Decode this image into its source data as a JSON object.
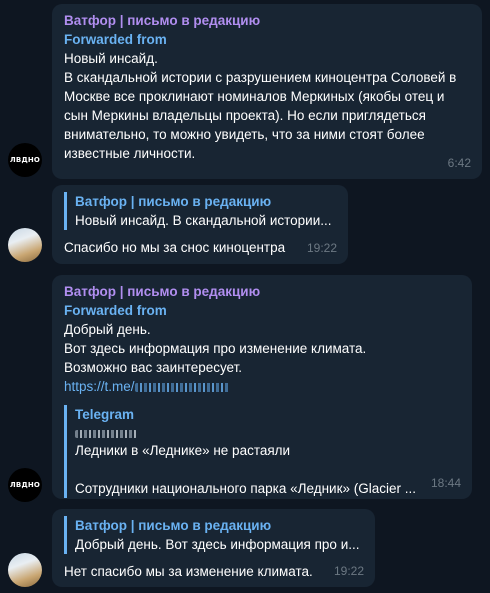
{
  "messages": [
    {
      "sender": "Ватфор | письмо в редакцию",
      "forwarded_label": "Forwarded from",
      "lines": [
        "Новый инсайд.",
        "В скандальной истории с разрушением киноцентра Соловей в",
        "Москве все проклинают номиналов Меркиных (якобы отец и",
        "сын Меркины владельцы проекта). Но если приглядеться",
        "внимательно, то можно увидеть, что за ними стоят более",
        "известные личности."
      ],
      "time": "6:42",
      "avatar_text": "ЛВДНО"
    },
    {
      "reply_title": "Ватфор | письмо в редакцию",
      "reply_text": "Новый инсайд. В скандальной истории...",
      "text": "Спасибо но мы за снос киноцентра",
      "time": "19:22"
    },
    {
      "sender": "Ватфор | письмо в редакцию",
      "forwarded_label": "Forwarded from",
      "lines": [
        "Добрый день.",
        "Вот здесь информация про изменение климата.",
        "Возможно вас заинтересует."
      ],
      "link": "https://t.me/",
      "preview_site": "Telegram",
      "preview_title": "Ледники в «Леднике» не растаяли",
      "preview_desc": "Сотрудники национального парка «Ледник» (Glacier ...",
      "time": "18:44",
      "avatar_text": "ЛВДНО"
    },
    {
      "reply_title": "Ватфор | письмо в редакцию",
      "reply_text": "Добрый день. Вот здесь информация про и...",
      "text": "Нет спасибо мы за изменение климата.",
      "time": "19:22"
    }
  ]
}
